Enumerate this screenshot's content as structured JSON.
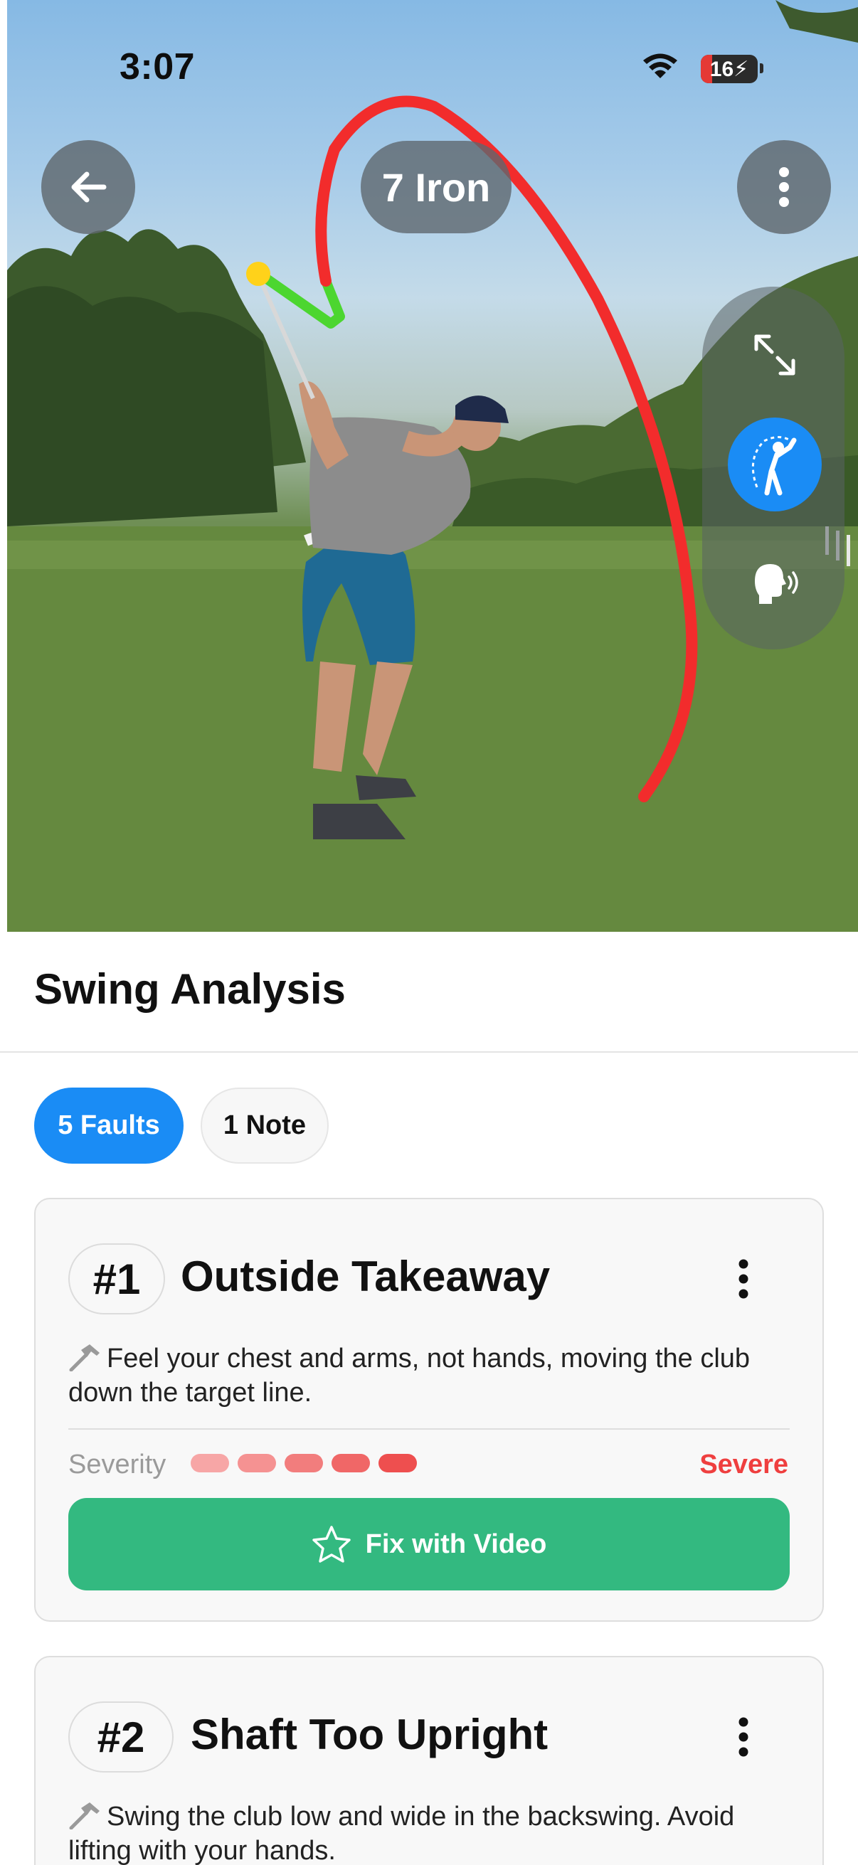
{
  "status_bar": {
    "time": "3:07",
    "battery": "16"
  },
  "video": {
    "club": "7 Iron"
  },
  "analysis": {
    "title": "Swing Analysis",
    "tabs": [
      {
        "label": "5 Faults",
        "active": true
      },
      {
        "label": "1 Note",
        "active": false
      }
    ],
    "faults": [
      {
        "number": "#1",
        "name": "Outside Takeaway",
        "tip": "Feel your chest and arms, not hands, moving the club down the target line.",
        "severity_label": "Severity",
        "severity_level": 5,
        "severity_max": 5,
        "severity_value": "Severe",
        "action_label": "Fix with Video"
      },
      {
        "number": "#2",
        "name": "Shaft Too Upright",
        "tip": "Swing the club low and wide in the backswing. Avoid lifting with your hands."
      }
    ]
  },
  "colors": {
    "accent_blue": "#1a8cf5",
    "fix_green": "#33b980",
    "severity_red": "#ef3f3f",
    "swing_path_red": "#f22c2c",
    "swing_path_green": "#4cd630"
  },
  "icons": [
    "back-arrow-icon",
    "more-vertical-icon",
    "expand-icon",
    "golfer-swing-icon",
    "voice-coach-icon",
    "hammer-icon",
    "star-icon",
    "wifi-icon",
    "battery-icon"
  ]
}
